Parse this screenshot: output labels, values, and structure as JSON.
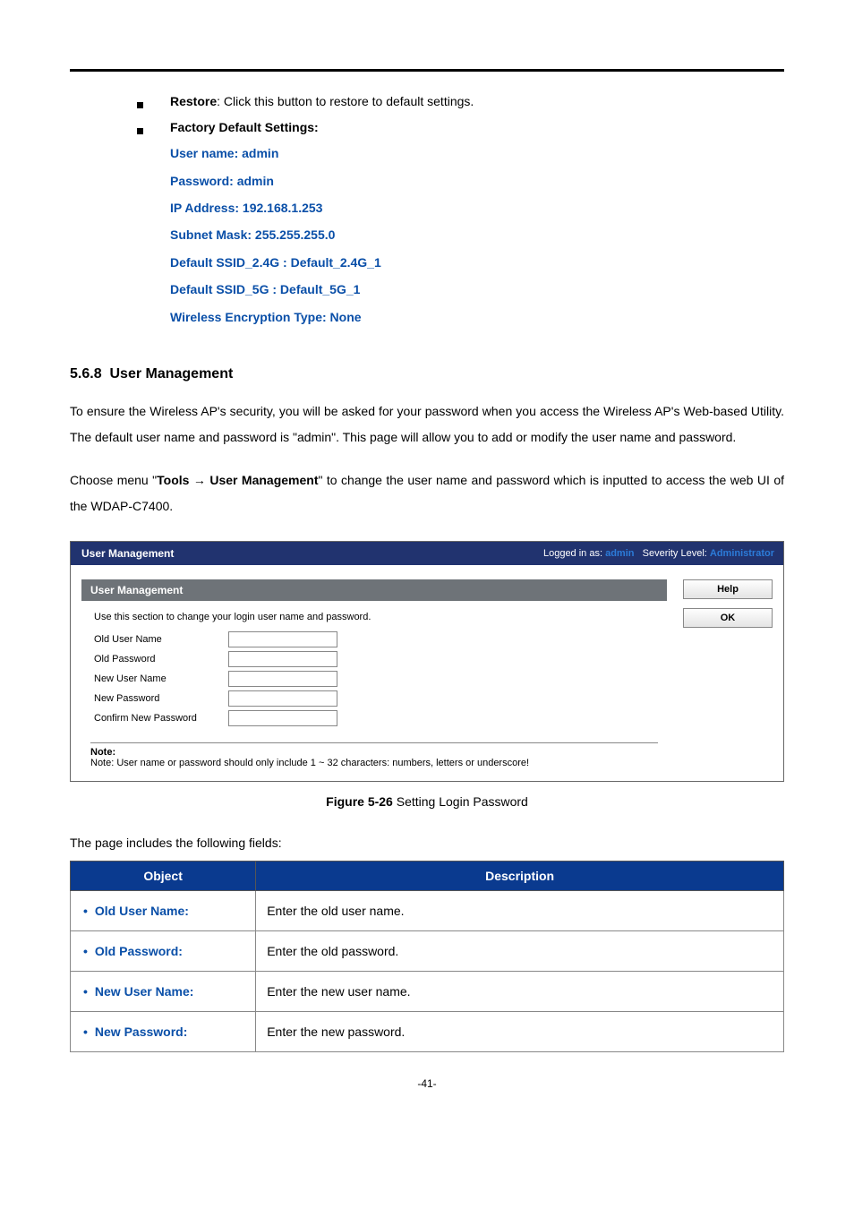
{
  "bullets": {
    "restore_label": "Restore",
    "restore_text": ": Click this button to restore to default settings.",
    "factory_label": "Factory Default Settings:"
  },
  "defaults": {
    "user_name": "User name: admin",
    "password": "Password: admin",
    "ip": "IP Address: 192.168.1.253",
    "subnet": "Subnet Mask: 255.255.255.0",
    "ssid24": "Default SSID_2.4G : Default_2.4G_1",
    "ssid5": "Default SSID_5G : Default_5G_1",
    "enc": "Wireless Encryption Type: None"
  },
  "section": {
    "number": "5.6.8",
    "title": "User Management",
    "para1": "To ensure the Wireless AP's security, you will be asked for your password when you access the Wireless AP's Web-based Utility. The default user name and password is \"admin\". This page will allow you to add or modify the user name and password.",
    "para2a": "Choose menu \"",
    "para2b": "Tools",
    "para2arrow": " → ",
    "para2c": "User Management",
    "para2d": "\" to change the user name and password which is inputted to access the web UI of the WDAP-C7400."
  },
  "fig": {
    "topbar_title": "User Management",
    "logged_label": "Logged in as: ",
    "logged_user": "admin",
    "sev_label": "Severity Level: ",
    "sev_value": "Administrator",
    "section_title": "User Management",
    "help_text": "Use this section to change your login user name and password.",
    "labels": {
      "old_user": "Old User Name",
      "old_pass": "Old Password",
      "new_user": "New User Name",
      "new_pass": "New Password",
      "confirm": "Confirm New Password"
    },
    "btn_help": "Help",
    "btn_ok": "OK",
    "note_title": "Note:",
    "note_body": "Note: User name or password should only include 1 ~ 32 characters: numbers, letters or underscore!",
    "caption_bold": "Figure 5-26",
    "caption_rest": " Setting Login Password"
  },
  "fields_intro": "The page includes the following fields:",
  "table": {
    "h1": "Object",
    "h2": "Description",
    "rows": [
      {
        "obj": "Old User Name:",
        "desc": "Enter the old user name."
      },
      {
        "obj": "Old Password:",
        "desc": "Enter the old password."
      },
      {
        "obj": "New User Name:",
        "desc": "Enter the new user name."
      },
      {
        "obj": "New Password:",
        "desc": "Enter the new password."
      }
    ]
  },
  "page_number": "-41-"
}
